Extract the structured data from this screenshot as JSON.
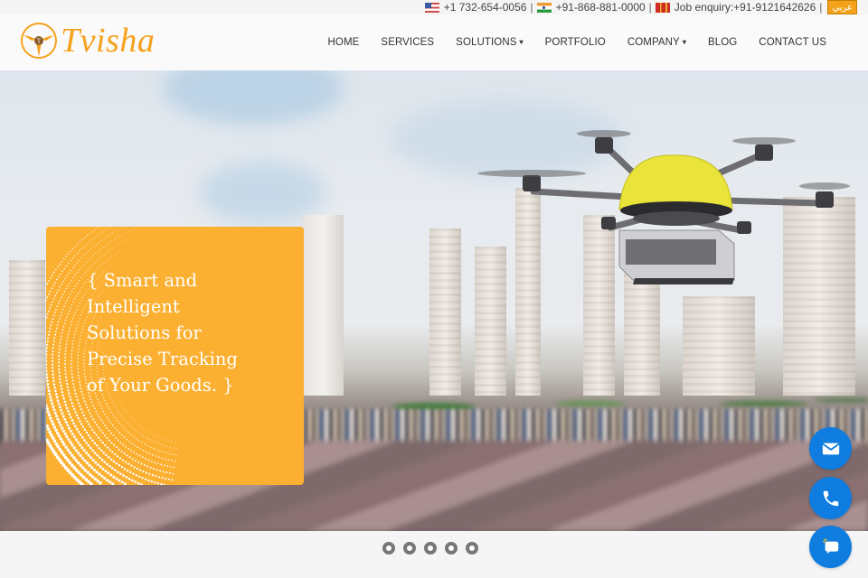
{
  "topbar": {
    "contacts": [
      {
        "flag": "us-flag-icon",
        "text": "+1 732-654-0056"
      },
      {
        "flag": "india-flag-icon",
        "text": "+91-868-881-0000"
      },
      {
        "flag": "job-icon",
        "text": "Job enquiry:+91-9121642626"
      }
    ],
    "separator": "|",
    "language_button": "عربي"
  },
  "header": {
    "logo_text": "Tvisha",
    "nav": [
      {
        "label": "HOME",
        "dropdown": false
      },
      {
        "label": "SERVICES",
        "dropdown": false
      },
      {
        "label": "SOLUTIONS",
        "dropdown": true
      },
      {
        "label": "PORTFOLIO",
        "dropdown": false
      },
      {
        "label": "COMPANY",
        "dropdown": true
      },
      {
        "label": "BLOG",
        "dropdown": false
      },
      {
        "label": "CONTACT US",
        "dropdown": false
      }
    ],
    "chevron": "▾"
  },
  "hero": {
    "card_lines": [
      "{ Smart and",
      "Intelligent",
      "Solutions for",
      "Precise Tracking",
      "of Your Goods. }"
    ],
    "slides_count": 5
  },
  "fabs": [
    {
      "name": "email-button",
      "icon": "envelope-icon"
    },
    {
      "name": "phone-button",
      "icon": "phone-icon"
    },
    {
      "name": "chat-button",
      "icon": "chat-bubble-icon"
    }
  ],
  "colors": {
    "brand_orange": "#f5a11c",
    "card_orange": "#fbb032",
    "fab_blue": "#0f7ce0"
  }
}
